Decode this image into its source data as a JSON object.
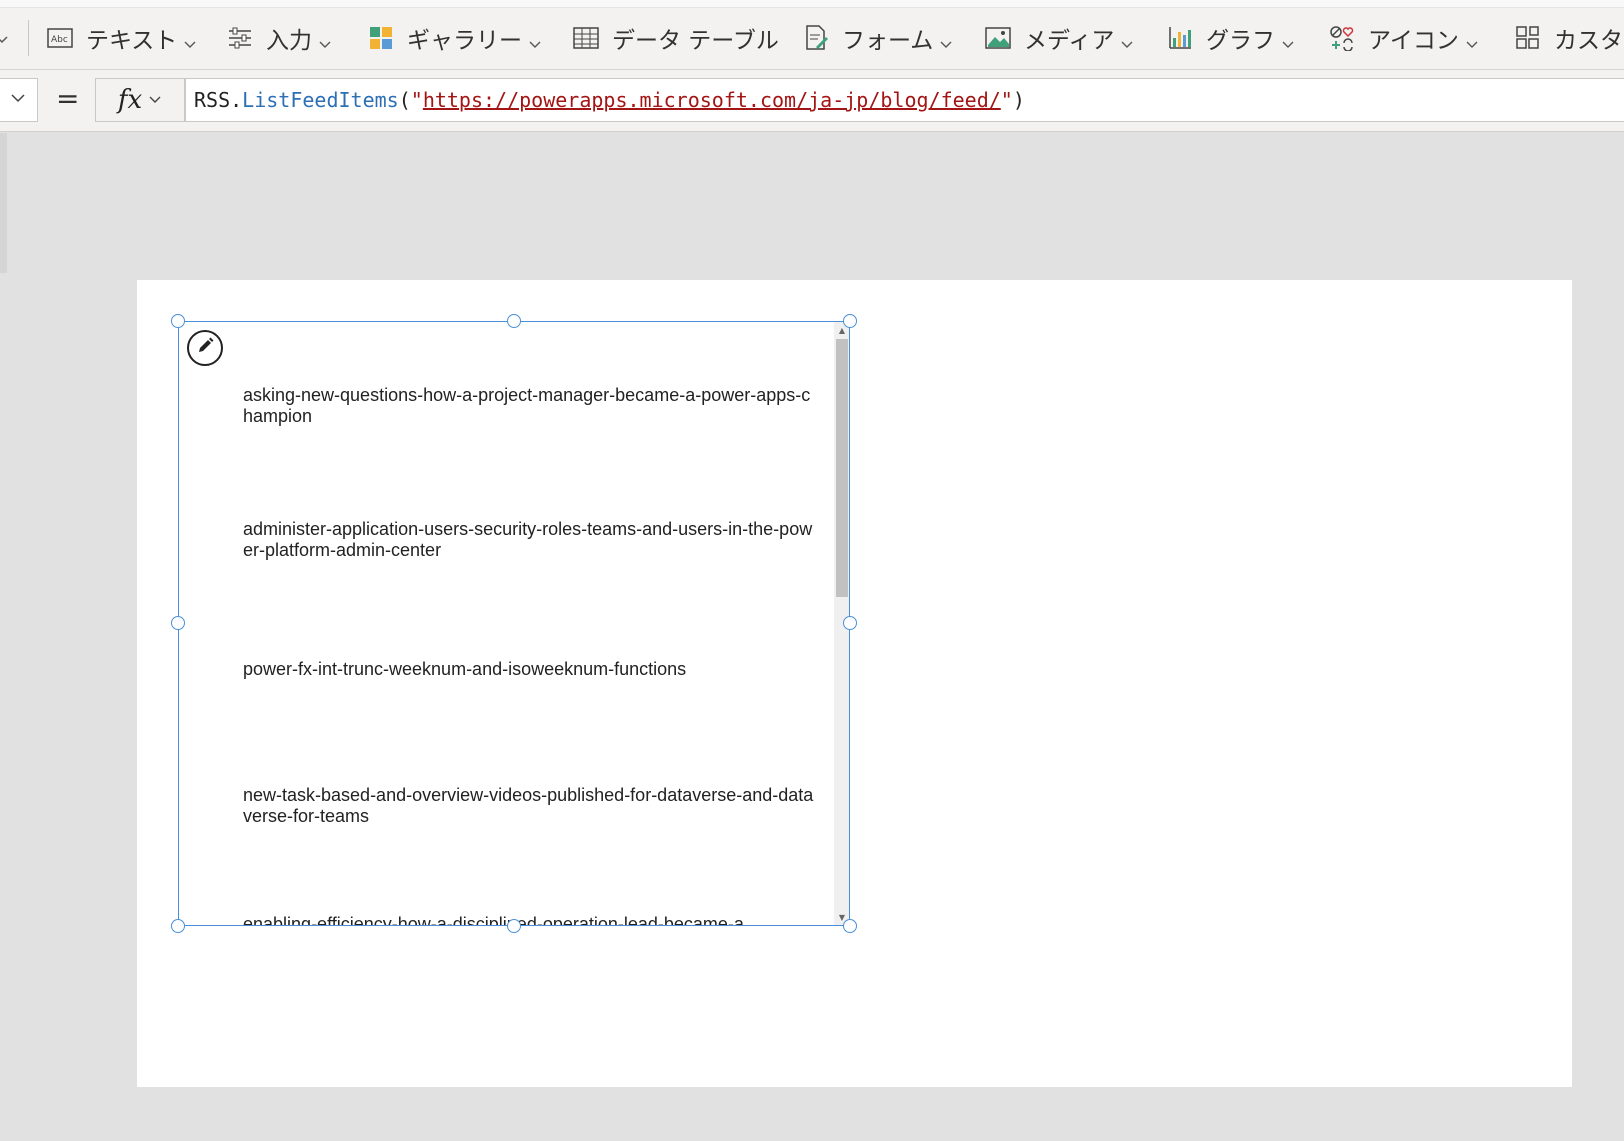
{
  "toolbar": {
    "items": [
      {
        "label": "テキスト",
        "icon": "text-label-icon"
      },
      {
        "label": "入力",
        "icon": "input-sliders-icon"
      },
      {
        "label": "ギャラリー",
        "icon": "gallery-icon"
      },
      {
        "label": "データ テーブル",
        "icon": "data-table-icon"
      },
      {
        "label": "フォーム",
        "icon": "form-icon"
      },
      {
        "label": "メディア",
        "icon": "media-icon"
      },
      {
        "label": "グラフ",
        "icon": "chart-icon"
      },
      {
        "label": "アイコン",
        "icon": "icons-icon"
      },
      {
        "label": "カスタム",
        "icon": "custom-icon"
      }
    ]
  },
  "formula": {
    "equals": "=",
    "fx": "fx",
    "prefix": "RSS.",
    "function": "ListFeedItems",
    "open": "(",
    "quote_open": "\"",
    "url": "https://powerapps.microsoft.com/ja-jp/blog/feed/",
    "quote_close": "\"",
    "close": ")"
  },
  "gallery": {
    "items": [
      "asking-new-questions-how-a-project-manager-became-a-power-apps-champion",
      "administer-application-users-security-roles-teams-and-users-in-the-power-platform-admin-center",
      "power-fx-int-trunc-weeknum-and-isoweeknum-functions",
      "new-task-based-and-overview-videos-published-for-dataverse-and-dataverse-for-teams",
      "enabling-efficiency-how-a-disciplined-operation-lead-became-a"
    ]
  },
  "colors": {
    "selection": "#4a8fd9",
    "function_blue": "#2d6fb5",
    "string_red": "#a31515"
  }
}
